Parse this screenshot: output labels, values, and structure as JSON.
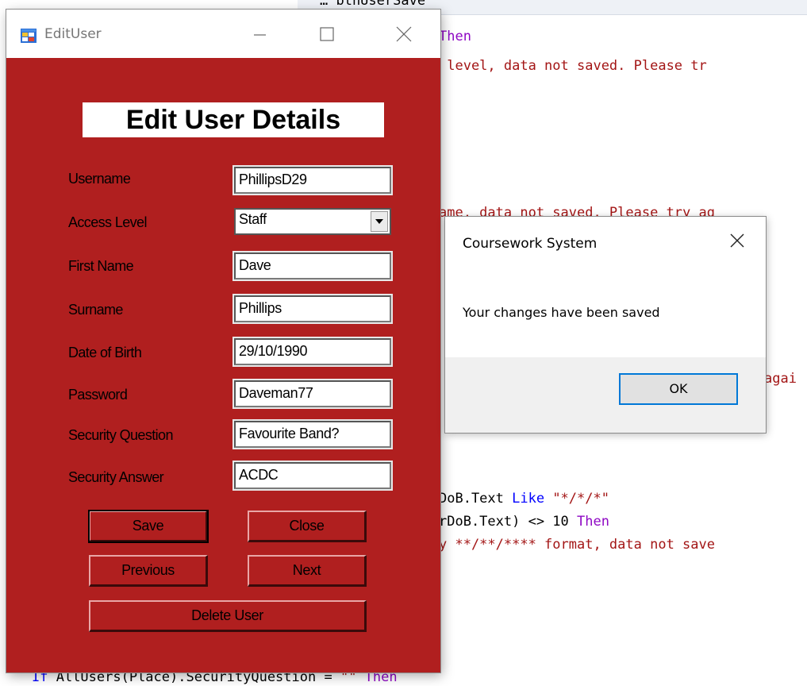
{
  "code_editor": {
    "line_top": "… btnUserSave",
    "line_then_1": "Then",
    "line_msg_1": " level, data not saved. Please tr",
    "line_msg_2": "ame, data not saved. Please try ag",
    "line_again": "agai",
    "line_like_a": "DoB.Text ",
    "line_like_kw": "Like",
    "line_like_str": " \"*/*/*\"",
    "line_len_a": "rDoB.Text) <> 10 ",
    "line_len_kw": "Then",
    "line_fmt": "y **/**/**** format, data not save",
    "line_if_kw": "If",
    "line_if_a": " AllUsers(Place).SecurityQuestion = ",
    "line_if_str": "\"\"",
    "line_if_kw2": " Then"
  },
  "edit_window": {
    "title": "EditUser",
    "heading": "Edit User Details",
    "fields": [
      {
        "label": "Username",
        "value": "PhillipsD29"
      },
      {
        "label": "Access Level",
        "value": "Staff"
      },
      {
        "label": "First Name",
        "value": "Dave"
      },
      {
        "label": "Surname",
        "value": "Phillips"
      },
      {
        "label": "Date of Birth",
        "value": "29/10/1990"
      },
      {
        "label": "Password",
        "value": "Daveman77"
      },
      {
        "label": "Security Question",
        "value": "Favourite Band?"
      },
      {
        "label": "Security Answer",
        "value": "ACDC"
      }
    ],
    "buttons": {
      "save": "Save",
      "close": "Close",
      "previous": "Previous",
      "next": "Next",
      "delete": "Delete User"
    }
  },
  "message_box": {
    "title": "Coursework System",
    "text": "Your changes have been saved",
    "ok": "OK"
  },
  "colors": {
    "form_background": "#b01f1f",
    "keyword": "#0000ff",
    "string": "#a31515",
    "accent": "#0078d7"
  },
  "icons": {
    "app": "windows-form-icon",
    "minimize": "minimize-icon",
    "maximize": "maximize-icon",
    "close": "close-icon",
    "dropdown": "chevron-down-icon"
  }
}
